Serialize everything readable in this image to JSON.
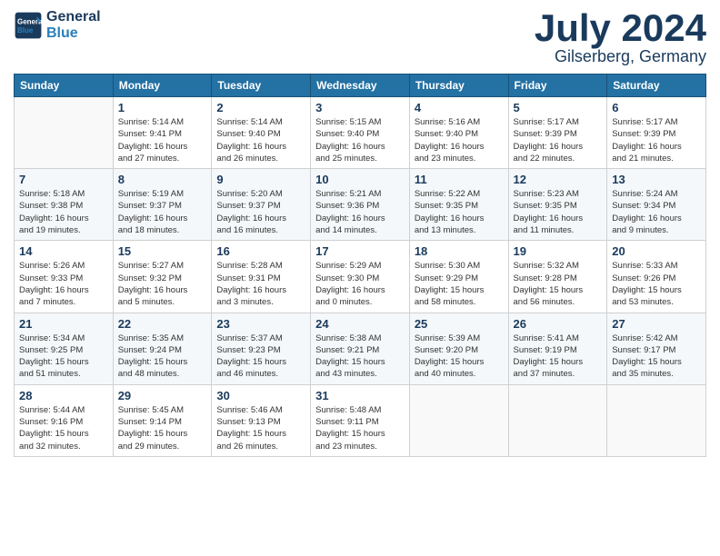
{
  "header": {
    "logo_line1": "General",
    "logo_line2": "Blue",
    "month": "July 2024",
    "location": "Gilserberg, Germany"
  },
  "weekdays": [
    "Sunday",
    "Monday",
    "Tuesday",
    "Wednesday",
    "Thursday",
    "Friday",
    "Saturday"
  ],
  "weeks": [
    [
      {
        "day": "",
        "info": ""
      },
      {
        "day": "1",
        "info": "Sunrise: 5:14 AM\nSunset: 9:41 PM\nDaylight: 16 hours\nand 27 minutes."
      },
      {
        "day": "2",
        "info": "Sunrise: 5:14 AM\nSunset: 9:40 PM\nDaylight: 16 hours\nand 26 minutes."
      },
      {
        "day": "3",
        "info": "Sunrise: 5:15 AM\nSunset: 9:40 PM\nDaylight: 16 hours\nand 25 minutes."
      },
      {
        "day": "4",
        "info": "Sunrise: 5:16 AM\nSunset: 9:40 PM\nDaylight: 16 hours\nand 23 minutes."
      },
      {
        "day": "5",
        "info": "Sunrise: 5:17 AM\nSunset: 9:39 PM\nDaylight: 16 hours\nand 22 minutes."
      },
      {
        "day": "6",
        "info": "Sunrise: 5:17 AM\nSunset: 9:39 PM\nDaylight: 16 hours\nand 21 minutes."
      }
    ],
    [
      {
        "day": "7",
        "info": "Sunrise: 5:18 AM\nSunset: 9:38 PM\nDaylight: 16 hours\nand 19 minutes."
      },
      {
        "day": "8",
        "info": "Sunrise: 5:19 AM\nSunset: 9:37 PM\nDaylight: 16 hours\nand 18 minutes."
      },
      {
        "day": "9",
        "info": "Sunrise: 5:20 AM\nSunset: 9:37 PM\nDaylight: 16 hours\nand 16 minutes."
      },
      {
        "day": "10",
        "info": "Sunrise: 5:21 AM\nSunset: 9:36 PM\nDaylight: 16 hours\nand 14 minutes."
      },
      {
        "day": "11",
        "info": "Sunrise: 5:22 AM\nSunset: 9:35 PM\nDaylight: 16 hours\nand 13 minutes."
      },
      {
        "day": "12",
        "info": "Sunrise: 5:23 AM\nSunset: 9:35 PM\nDaylight: 16 hours\nand 11 minutes."
      },
      {
        "day": "13",
        "info": "Sunrise: 5:24 AM\nSunset: 9:34 PM\nDaylight: 16 hours\nand 9 minutes."
      }
    ],
    [
      {
        "day": "14",
        "info": "Sunrise: 5:26 AM\nSunset: 9:33 PM\nDaylight: 16 hours\nand 7 minutes."
      },
      {
        "day": "15",
        "info": "Sunrise: 5:27 AM\nSunset: 9:32 PM\nDaylight: 16 hours\nand 5 minutes."
      },
      {
        "day": "16",
        "info": "Sunrise: 5:28 AM\nSunset: 9:31 PM\nDaylight: 16 hours\nand 3 minutes."
      },
      {
        "day": "17",
        "info": "Sunrise: 5:29 AM\nSunset: 9:30 PM\nDaylight: 16 hours\nand 0 minutes."
      },
      {
        "day": "18",
        "info": "Sunrise: 5:30 AM\nSunset: 9:29 PM\nDaylight: 15 hours\nand 58 minutes."
      },
      {
        "day": "19",
        "info": "Sunrise: 5:32 AM\nSunset: 9:28 PM\nDaylight: 15 hours\nand 56 minutes."
      },
      {
        "day": "20",
        "info": "Sunrise: 5:33 AM\nSunset: 9:26 PM\nDaylight: 15 hours\nand 53 minutes."
      }
    ],
    [
      {
        "day": "21",
        "info": "Sunrise: 5:34 AM\nSunset: 9:25 PM\nDaylight: 15 hours\nand 51 minutes."
      },
      {
        "day": "22",
        "info": "Sunrise: 5:35 AM\nSunset: 9:24 PM\nDaylight: 15 hours\nand 48 minutes."
      },
      {
        "day": "23",
        "info": "Sunrise: 5:37 AM\nSunset: 9:23 PM\nDaylight: 15 hours\nand 46 minutes."
      },
      {
        "day": "24",
        "info": "Sunrise: 5:38 AM\nSunset: 9:21 PM\nDaylight: 15 hours\nand 43 minutes."
      },
      {
        "day": "25",
        "info": "Sunrise: 5:39 AM\nSunset: 9:20 PM\nDaylight: 15 hours\nand 40 minutes."
      },
      {
        "day": "26",
        "info": "Sunrise: 5:41 AM\nSunset: 9:19 PM\nDaylight: 15 hours\nand 37 minutes."
      },
      {
        "day": "27",
        "info": "Sunrise: 5:42 AM\nSunset: 9:17 PM\nDaylight: 15 hours\nand 35 minutes."
      }
    ],
    [
      {
        "day": "28",
        "info": "Sunrise: 5:44 AM\nSunset: 9:16 PM\nDaylight: 15 hours\nand 32 minutes."
      },
      {
        "day": "29",
        "info": "Sunrise: 5:45 AM\nSunset: 9:14 PM\nDaylight: 15 hours\nand 29 minutes."
      },
      {
        "day": "30",
        "info": "Sunrise: 5:46 AM\nSunset: 9:13 PM\nDaylight: 15 hours\nand 26 minutes."
      },
      {
        "day": "31",
        "info": "Sunrise: 5:48 AM\nSunset: 9:11 PM\nDaylight: 15 hours\nand 23 minutes."
      },
      {
        "day": "",
        "info": ""
      },
      {
        "day": "",
        "info": ""
      },
      {
        "day": "",
        "info": ""
      }
    ]
  ]
}
